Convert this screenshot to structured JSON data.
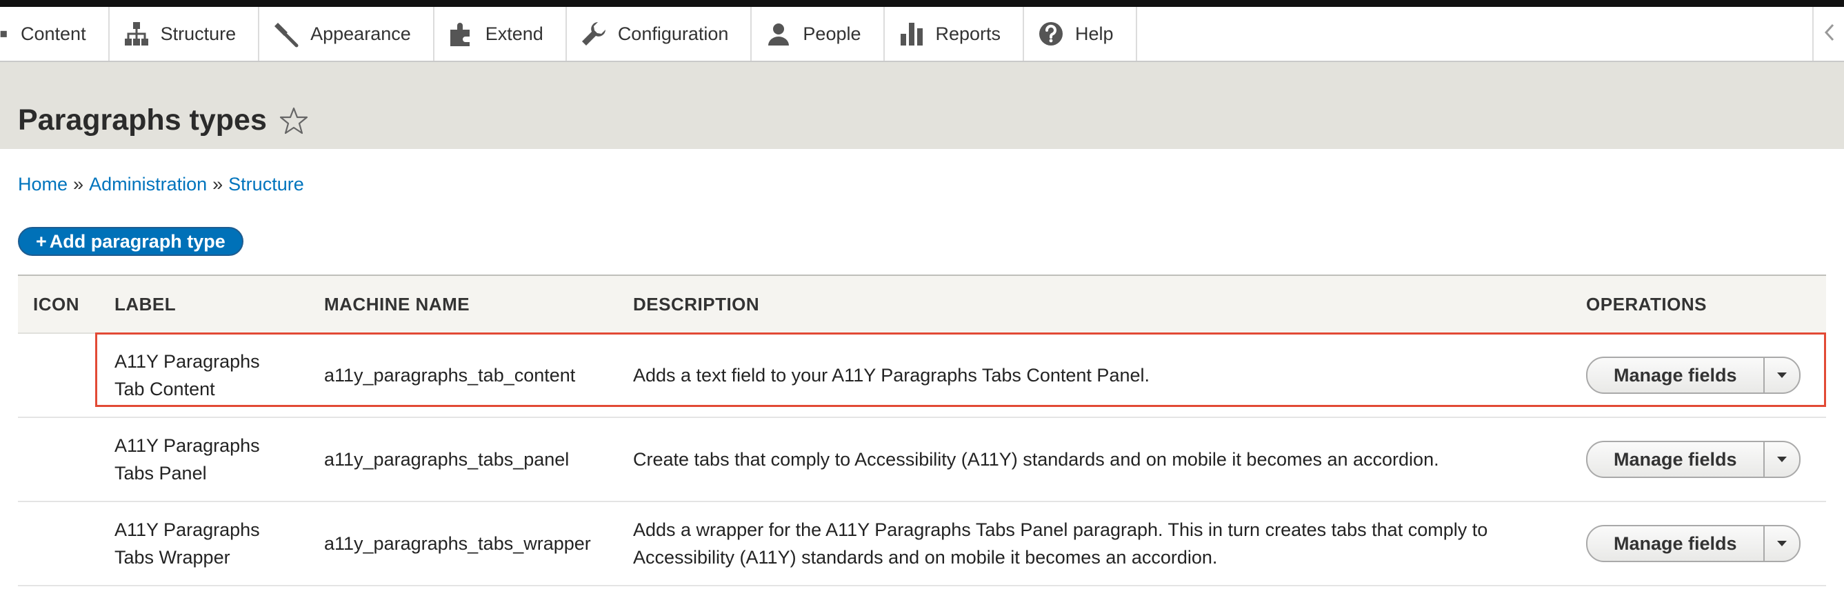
{
  "toolbar": {
    "items": [
      {
        "label": "Content",
        "icon": "content-icon"
      },
      {
        "label": "Structure",
        "icon": "structure-icon"
      },
      {
        "label": "Appearance",
        "icon": "appearance-icon"
      },
      {
        "label": "Extend",
        "icon": "extend-icon"
      },
      {
        "label": "Configuration",
        "icon": "wrench-icon"
      },
      {
        "label": "People",
        "icon": "people-icon"
      },
      {
        "label": "Reports",
        "icon": "reports-icon"
      },
      {
        "label": "Help",
        "icon": "help-icon"
      }
    ]
  },
  "page": {
    "title": "Paragraphs types"
  },
  "breadcrumb": {
    "items": [
      "Home",
      "Administration",
      "Structure"
    ],
    "separator": "»"
  },
  "actions": {
    "add_plus": "+",
    "add_label": "Add paragraph type"
  },
  "table": {
    "headers": [
      "ICON",
      "LABEL",
      "MACHINE NAME",
      "DESCRIPTION",
      "OPERATIONS"
    ],
    "rows": [
      {
        "icon": "",
        "label_line1": "A11Y Paragraphs",
        "label_line2": "Tab Content",
        "machine_name": "a11y_paragraphs_tab_content",
        "description": "Adds a text field to your A11Y Paragraphs Tabs Content Panel.",
        "operation": "Manage fields"
      },
      {
        "icon": "",
        "label_line1": "A11Y Paragraphs",
        "label_line2": "Tabs Panel",
        "machine_name": "a11y_paragraphs_tabs_panel",
        "description": "Create tabs that comply to Accessibility (A11Y) standards and on mobile it becomes an accordion.",
        "operation": "Manage fields"
      },
      {
        "icon": "",
        "label_line1": "A11Y Paragraphs",
        "label_line2": "Tabs Wrapper",
        "machine_name": "a11y_paragraphs_tabs_wrapper",
        "description_line1": "Adds a wrapper for the A11Y Paragraphs Tabs Panel paragraph. This in turn creates tabs that comply to",
        "description_line2": "Accessibility (A11Y) standards and on mobile it becomes an accordion.",
        "operation": "Manage fields"
      }
    ]
  },
  "colors": {
    "link": "#0074bd",
    "primary_button": "#0071b8",
    "header_band": "#e3e2dc",
    "highlight": "#e24a35"
  }
}
